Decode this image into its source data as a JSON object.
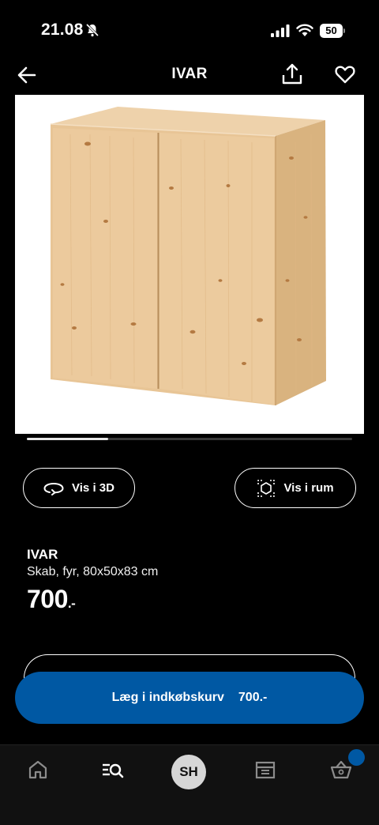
{
  "status_bar": {
    "time": "21.08",
    "battery": "50"
  },
  "nav": {
    "title": "IVAR"
  },
  "gallery": {
    "progress": 0.25
  },
  "actions": {
    "view_3d_label": "Vis i 3D",
    "view_room_label": "Vis i rum"
  },
  "product": {
    "name": "IVAR",
    "description": "Skab, fyr, 80x50x83 cm",
    "price": "700",
    "price_suffix": ".-"
  },
  "cart_button": {
    "label": "Læg i indkøbskurv",
    "price": "700.-"
  },
  "tab_bar": {
    "profile_initials": "SH"
  },
  "colors": {
    "accent": "#0058a3",
    "background": "#000000",
    "wood": "#e8c79c"
  }
}
